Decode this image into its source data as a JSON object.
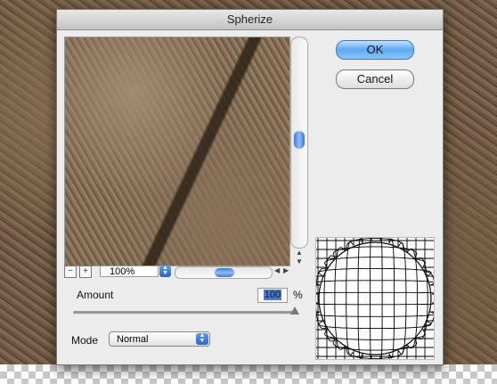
{
  "dialog": {
    "title": "Spherize",
    "ok_label": "OK",
    "cancel_label": "Cancel"
  },
  "preview": {
    "zoom_out_icon": "minus-icon",
    "zoom_in_icon": "plus-icon",
    "zoom_level": "100%",
    "zoom_out_label": "−",
    "zoom_in_label": "+"
  },
  "amount": {
    "label": "Amount",
    "value": "100",
    "unit": "%",
    "slider_fraction": 1.0
  },
  "mode": {
    "label": "Mode",
    "selected": "Normal"
  },
  "colors": {
    "accent": "#5ea8f2",
    "selection": "#4a7bd0"
  }
}
